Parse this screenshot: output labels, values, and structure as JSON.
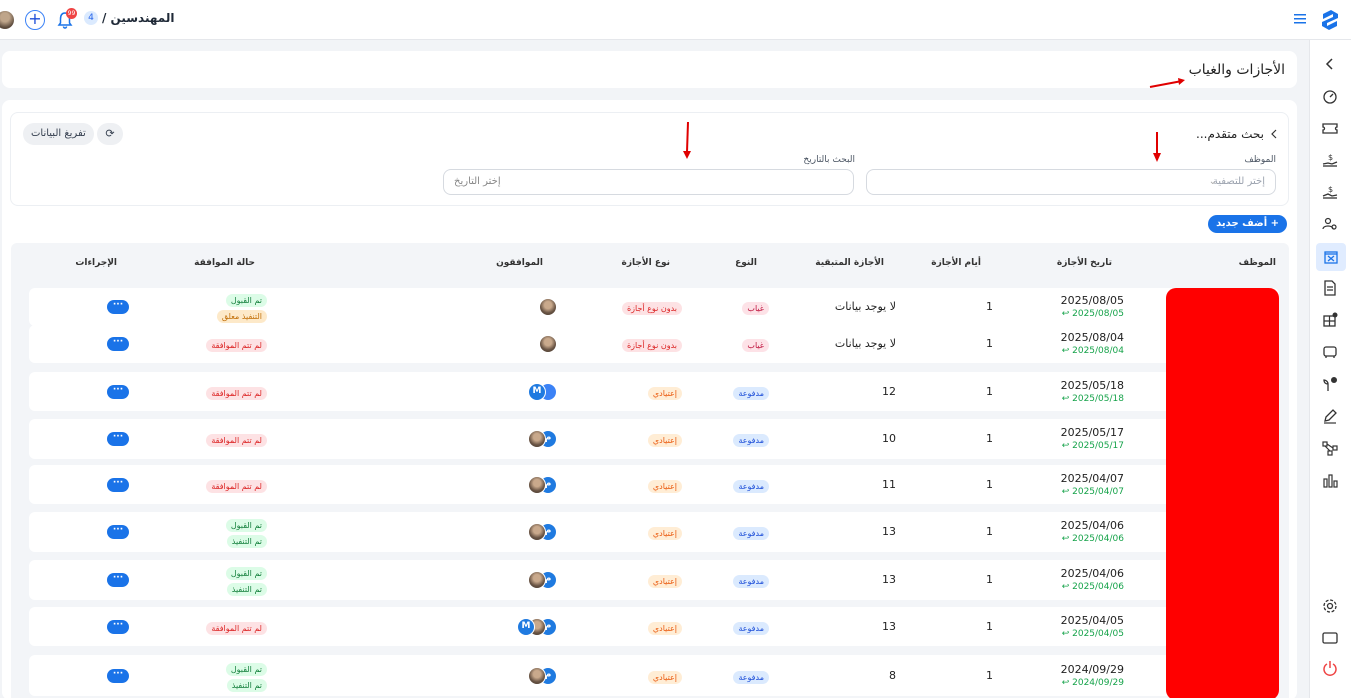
{
  "header": {
    "breadcrumb_title": "المهندسين /",
    "breadcrumb_count": "4",
    "notification_count": "99"
  },
  "page": {
    "title": "الأجازات والغياب"
  },
  "filters": {
    "advanced_search": "بحث متقدم...",
    "employee_label": "الموظف",
    "employee_placeholder": "إختر للتصفية",
    "date_label": "البحث بالتاريخ",
    "date_placeholder": "إختر التاريخ",
    "clear_button": "تفريغ البيانات"
  },
  "add_button": "+ أضف جديد",
  "table": {
    "headers": {
      "employee": "الموظف",
      "leave_date": "تاريخ الأجازة",
      "leave_days": "أيام الأجازة",
      "remaining": "الأجازة المتبقية",
      "type": "النوع",
      "leave_type": "نوع الأجازة",
      "approvers": "الموافقون",
      "approval_status": "حالة الموافقة",
      "actions": "الإجراءات"
    },
    "rows": [
      {
        "date": "2025/08/05",
        "date_to": "2025/08/05 ↩",
        "days": "1",
        "remaining": "لا يوجد بيانات",
        "type": "غياب",
        "leave_type": "بدون نوع أجازة",
        "status": [
          "تم القبول",
          "التنفيذ معلق"
        ],
        "approvers": [
          "photo"
        ]
      },
      {
        "date": "2025/08/04",
        "date_to": "2025/08/04 ↩",
        "days": "1",
        "remaining": "لا يوجد بيانات",
        "type": "غياب",
        "leave_type": "بدون نوع أجازة",
        "status": [
          "لم تتم الموافقة"
        ],
        "approvers": [
          "photo"
        ]
      },
      {
        "date": "2025/05/18",
        "date_to": "2025/05/18 ↩",
        "days": "1",
        "remaining": "12",
        "type": "مدفوعة",
        "leave_type": "إعتيادي",
        "status": [
          "لم تتم الموافقة"
        ],
        "approvers": [
          "logo",
          "M"
        ]
      },
      {
        "date": "2025/05/17",
        "date_to": "2025/05/17 ↩",
        "days": "1",
        "remaining": "10",
        "type": "مدفوعة",
        "leave_type": "إعتيادي",
        "status": [
          "لم تتم الموافقة"
        ],
        "approvers": [
          "م",
          "photo"
        ]
      },
      {
        "date": "2025/04/07",
        "date_to": "2025/04/07 ↩",
        "days": "1",
        "remaining": "11",
        "type": "مدفوعة",
        "leave_type": "إعتيادي",
        "status": [
          "لم تتم الموافقة"
        ],
        "approvers": [
          "م",
          "photo"
        ]
      },
      {
        "date": "2025/04/06",
        "date_to": "2025/04/06 ↩",
        "days": "1",
        "remaining": "13",
        "type": "مدفوعة",
        "leave_type": "إعتيادي",
        "status": [
          "تم القبول",
          "تم التنفيذ"
        ],
        "approvers": [
          "م",
          "photo"
        ]
      },
      {
        "date": "2025/04/06",
        "date_to": "2025/04/06 ↩",
        "days": "1",
        "remaining": "13",
        "type": "مدفوعة",
        "leave_type": "إعتيادي",
        "status": [
          "تم القبول",
          "تم التنفيذ"
        ],
        "approvers": [
          "م",
          "photo"
        ]
      },
      {
        "date": "2025/04/05",
        "date_to": "2025/04/05 ↩",
        "days": "1",
        "remaining": "13",
        "type": "مدفوعة",
        "leave_type": "إعتيادي",
        "status": [
          "لم تتم الموافقة"
        ],
        "approvers": [
          "م",
          "photo",
          "M"
        ]
      },
      {
        "date": "2024/09/29",
        "date_to": "2024/09/29 ↩",
        "days": "1",
        "remaining": "8",
        "type": "مدفوعة",
        "leave_type": "إعتيادي",
        "status": [
          "تم القبول",
          "تم التنفيذ"
        ],
        "approvers": [
          "م",
          "photo"
        ]
      }
    ],
    "actions_label": "···"
  },
  "sidebar_icons": [
    "chevron-left-icon",
    "dashboard-gauge-icon",
    "ticket-icon",
    "salary-hand-icon",
    "payment-hand-icon",
    "users-settings-icon",
    "calendar-x-icon",
    "document-icon",
    "box-badge-icon",
    "car-icon",
    "plant-check-icon",
    "pen-icon",
    "workflow-icon",
    "bar-chart-icon",
    "settings-icon",
    "monitor-icon",
    "power-icon"
  ],
  "colors": {
    "primary": "#1a73e8",
    "redaction": "#ff0000",
    "annotation_arrow": "#e00000"
  }
}
